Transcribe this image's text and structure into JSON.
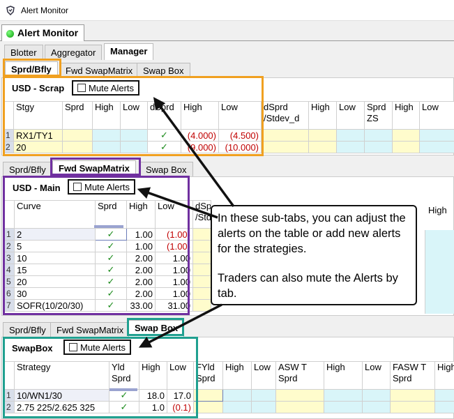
{
  "window": {
    "title": "Alert Monitor"
  },
  "main_tab": {
    "label": "Alert Monitor"
  },
  "top_tabs": [
    "Blotter",
    "Aggregator",
    "Manager"
  ],
  "sub_tabs": [
    "Sprd/Bfly",
    "Fwd SwapMatrix",
    "Swap Box"
  ],
  "scrap": {
    "title": "USD - Scrap",
    "mute_label": "Mute Alerts",
    "columns": [
      "Stgy",
      "Sprd",
      "High",
      "Low",
      "dSprd",
      "High",
      "Low",
      "dSprd /Stdev_d",
      "High",
      "Low",
      "Sprd ZS",
      "High",
      "Low"
    ],
    "rows": [
      {
        "num": "1",
        "stgy": "RX1/TY1",
        "check": "✓",
        "high": "(4.000)",
        "low": "(4.500)"
      },
      {
        "num": "2",
        "stgy": "20",
        "check": "✓",
        "high": "(9.000)",
        "low": "(10.000)"
      }
    ]
  },
  "main": {
    "title": "USD - Main",
    "mute_label": "Mute Alerts",
    "columns": [
      "Curve",
      "Sprd",
      "High",
      "Low",
      "dSprd /Std",
      "High"
    ],
    "rows": [
      {
        "num": "1",
        "curve": "2",
        "check": "✓",
        "high": "1.00",
        "low": "(1.00)"
      },
      {
        "num": "2",
        "curve": "5",
        "check": "✓",
        "high": "1.00",
        "low": "(1.00)"
      },
      {
        "num": "3",
        "curve": "10",
        "check": "✓",
        "high": "2.00",
        "low": "1.00"
      },
      {
        "num": "4",
        "curve": "15",
        "check": "✓",
        "high": "2.00",
        "low": "1.00"
      },
      {
        "num": "5",
        "curve": "20",
        "check": "✓",
        "high": "2.00",
        "low": "1.00"
      },
      {
        "num": "6",
        "curve": "30",
        "check": "✓",
        "high": "2.00",
        "low": "1.00"
      },
      {
        "num": "7",
        "curve": "SOFR(10/20/30)",
        "check": "✓",
        "high": "33.00",
        "low": "31.00"
      }
    ]
  },
  "swapbox": {
    "title": "SwapBox",
    "mute_label": "Mute Alerts",
    "columns": [
      "Strategy",
      "Yld Sprd",
      "High",
      "Low",
      "FYld Sprd",
      "High",
      "Low",
      "ASW T Sprd",
      "High",
      "Low",
      "FASW T Sprd",
      "High"
    ],
    "rows": [
      {
        "num": "1",
        "strategy": "10/WN1/30",
        "check": "✓",
        "high": "18.0",
        "low": "17.0"
      },
      {
        "num": "2",
        "strategy": "2.75 225/2.625 325",
        "check": "✓",
        "high": "1.0",
        "low": "(0.1)"
      }
    ]
  },
  "callout": {
    "line1": "In these sub-tabs, you can adjust the alerts on the table or add new alerts for the strategies.",
    "line2": "Traders can also mute the Alerts by tab."
  },
  "colors": {
    "orange_frame": "#f0a020",
    "purple_frame": "#7030a0",
    "teal_frame": "#20a090",
    "loss_red": "#c00000",
    "check_green": "#1a8a1a"
  }
}
